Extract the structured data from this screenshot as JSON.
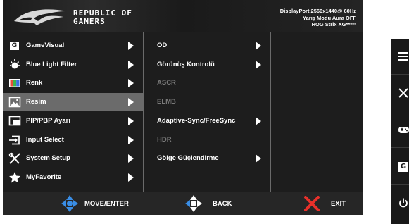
{
  "header": {
    "brand_line1": "REPUBLIC OF",
    "brand_line2": "GAMERS",
    "info_line1": "DisplayPort 2560x1440@ 60Hz",
    "info_line2": "Yarış Modu Aura OFF",
    "info_line3": "ROG Strix XG*****"
  },
  "main_menu": {
    "selected_index": 3,
    "items": [
      {
        "label": "GameVisual",
        "icon": "gamevisual-icon"
      },
      {
        "label": "Blue Light Filter",
        "icon": "blue-light-icon"
      },
      {
        "label": "Renk",
        "icon": "color-icon"
      },
      {
        "label": "Resim",
        "icon": "image-icon"
      },
      {
        "label": "PIP/PBP Ayarı",
        "icon": "pip-icon"
      },
      {
        "label": "Input Select",
        "icon": "input-icon"
      },
      {
        "label": "System Setup",
        "icon": "system-setup-icon"
      },
      {
        "label": "MyFavorite",
        "icon": "star-icon"
      }
    ],
    "gamevisual_glyph": "G"
  },
  "submenu": {
    "items": [
      {
        "label": "OD",
        "enabled": true,
        "has_arrow": true
      },
      {
        "label": "Görünüş Kontrolü",
        "enabled": true,
        "has_arrow": true
      },
      {
        "label": "ASCR",
        "enabled": false,
        "has_arrow": false
      },
      {
        "label": "ELMB",
        "enabled": false,
        "has_arrow": false
      },
      {
        "label": "Adaptive-Sync/FreeSync",
        "enabled": true,
        "has_arrow": true
      },
      {
        "label": "HDR",
        "enabled": false,
        "has_arrow": false
      },
      {
        "label": "Gölge Güçlendirme",
        "enabled": true,
        "has_arrow": true
      }
    ]
  },
  "footer": {
    "move_label": "MOVE/ENTER",
    "back_label": "BACK",
    "exit_label": "EXIT"
  },
  "hotkeys": {
    "items": [
      "menu-icon",
      "close-icon",
      "gamepad-icon",
      "gamevisual-icon",
      "power-icon"
    ],
    "gamevisual_glyph": "G"
  },
  "colors": {
    "panel_bg": "#1d1d1d",
    "selected_bg": "#6b6b6b",
    "disabled_text": "#7a7a7a",
    "nav_blue": "#3a8ee6",
    "exit_red": "#e8302a"
  }
}
